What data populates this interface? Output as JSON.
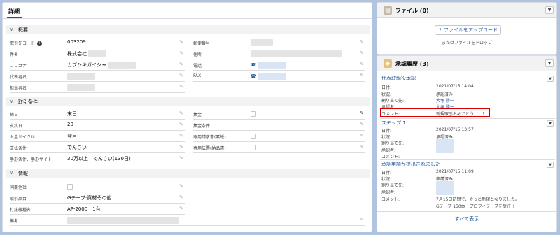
{
  "tabs": {
    "detail": "詳細"
  },
  "sections": {
    "overview": {
      "title": "概要",
      "left": [
        {
          "label": "取引先コード",
          "value": "003209"
        },
        {
          "label": "件名",
          "value": "株式会社"
        },
        {
          "label": "フリガナ",
          "value": "カブシキガイシャ"
        },
        {
          "label": "代表者名",
          "value": ""
        },
        {
          "label": "担当者名",
          "value": ""
        }
      ],
      "right": [
        {
          "label": "郵便番号",
          "value": ""
        },
        {
          "label": "住所",
          "value": ""
        },
        {
          "label": "電話",
          "value": ""
        },
        {
          "label": "FAX",
          "value": ""
        }
      ]
    },
    "terms": {
      "title": "取引条件",
      "left": [
        {
          "label": "締日",
          "value": "末日"
        },
        {
          "label": "支払日",
          "value": "20"
        },
        {
          "label": "入金サイクル",
          "value": "翌月"
        },
        {
          "label": "支払条件",
          "value": "でんさい"
        },
        {
          "label": "手形条件、手形サイト",
          "value": "30万以上　でんさい(130日)"
        }
      ],
      "right": [
        {
          "label": "集金",
          "value": ""
        },
        {
          "label": "集金条件",
          "value": ""
        },
        {
          "label": "専用請求書(素紙)",
          "value": ""
        },
        {
          "label": "専用伝票(納品書)",
          "value": ""
        }
      ]
    },
    "info": {
      "title": "情報",
      "rows": [
        {
          "label": "同業他社",
          "value": ""
        },
        {
          "label": "取引品目",
          "value": "Gテープ·資材その他"
        },
        {
          "label": "打抜機種名",
          "value": "AP-2000　1台"
        },
        {
          "label": "備考",
          "value": ""
        }
      ]
    }
  },
  "files": {
    "title": "ファイル (0)",
    "upload_label": "ファイルをアップロード",
    "drop_text": "またはファイルをドロップ"
  },
  "approval": {
    "title": "承認履歴 (3)",
    "entries": [
      {
        "name": "代表取締役承認",
        "rows": [
          {
            "label": "日付:",
            "value": "2021/07/15 14:04"
          },
          {
            "label": "状況:",
            "value": "承認済み"
          },
          {
            "label": "割り当て先:",
            "value": "大塚 勝一"
          },
          {
            "label": "承認者:",
            "value": "大塚 勝一"
          },
          {
            "label": "コメント:",
            "value": "新規取引おめでとう！！！"
          }
        ]
      },
      {
        "name": "ステップ 1",
        "rows": [
          {
            "label": "日付:",
            "value": "2021/07/15 13:57"
          },
          {
            "label": "状況:",
            "value": "承認済み"
          },
          {
            "label": "割り当て先:",
            "value": ""
          },
          {
            "label": "承認者:",
            "value": ""
          },
          {
            "label": "コメント:",
            "value": ""
          }
        ]
      },
      {
        "name": "承認申請が提出されました",
        "rows": [
          {
            "label": "日付:",
            "value": "2021/07/15 11:09"
          },
          {
            "label": "状況:",
            "value": "申請済み"
          },
          {
            "label": "割り当て先:",
            "value": ""
          },
          {
            "label": "承認者:",
            "value": ""
          },
          {
            "label": "コメント:",
            "value": "7月15日訪問で、やっと新規となりました。"
          },
          {
            "label": "",
            "value": "Gテープ 150本　プロフィテープを受注!!"
          }
        ]
      }
    ],
    "view_all": "すべて表示"
  },
  "colors": {
    "accent": "#1b5297",
    "highlight_border": "#d60000",
    "background": "#b0c4df",
    "files_icon": "#c3b9a8",
    "approval_icon": "#e8c27a"
  },
  "icons": {
    "edit": "pencil-icon",
    "phone": "phone-icon",
    "info": "info-icon",
    "upload": "upload-icon",
    "files": "file-icon",
    "approval": "approval-icon"
  }
}
